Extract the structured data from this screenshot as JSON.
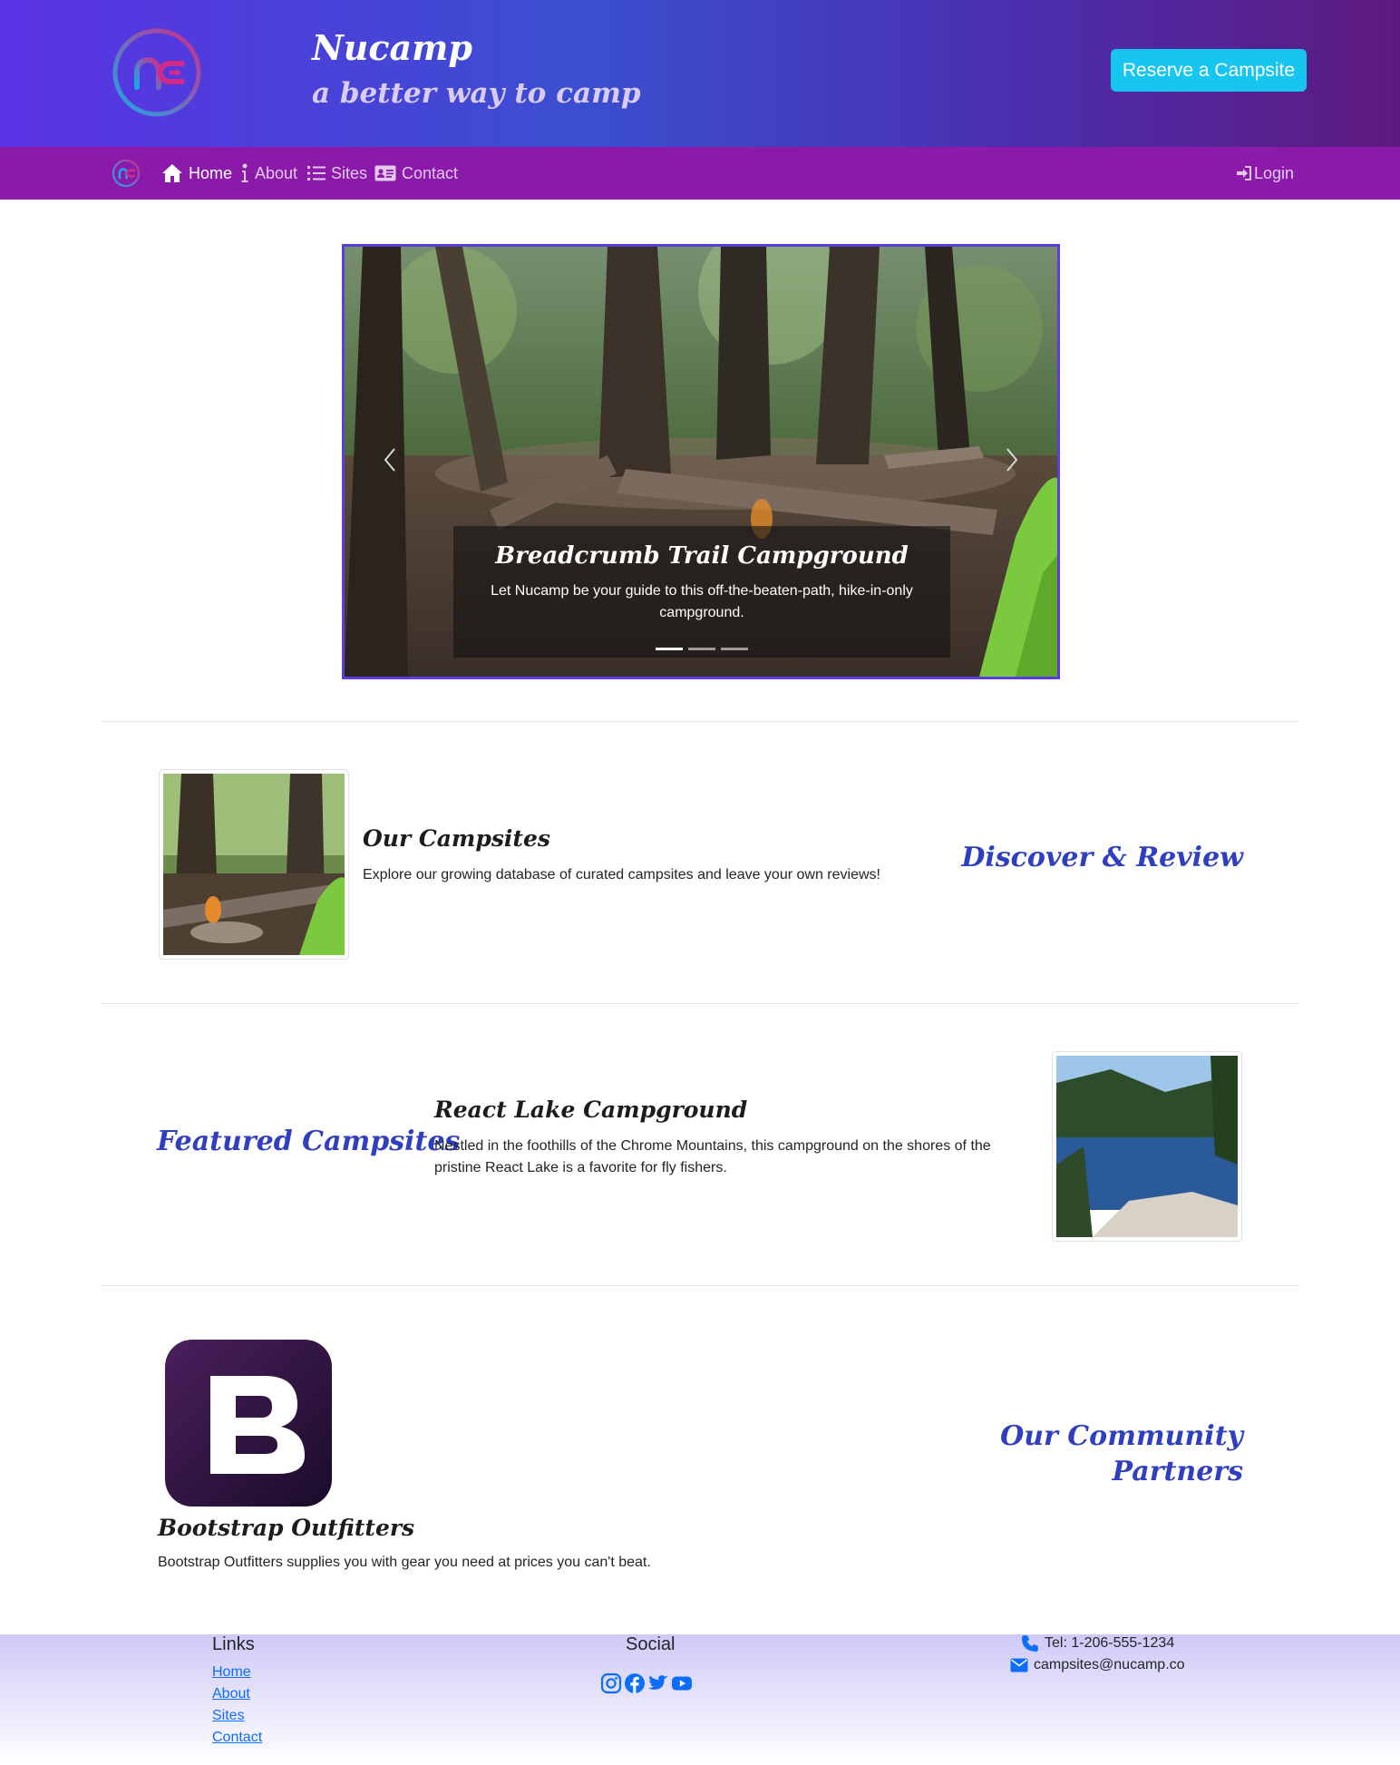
{
  "header": {
    "logo_icon": "nucamp-logo-icon",
    "brand_title": "Nucamp",
    "tagline": "a better way to camp",
    "reserve_button": "Reserve a Campsite",
    "colors": {
      "gradient_start": "#5b32e4",
      "gradient_end": "#5e1a7e",
      "button": "#17c6f0"
    }
  },
  "navbar": {
    "background": "#8b1aab",
    "items": [
      {
        "label": "Home",
        "icon": "home-icon",
        "active": true
      },
      {
        "label": "About",
        "icon": "info-icon",
        "active": false
      },
      {
        "label": "Sites",
        "icon": "list-icon",
        "active": false
      },
      {
        "label": "Contact",
        "icon": "address-card-icon",
        "active": false
      }
    ],
    "login": {
      "label": "Login",
      "icon": "sign-in-icon"
    }
  },
  "carousel": {
    "caption_title": "Breadcrumb Trail Campground",
    "caption_text": "Let Nucamp be your guide to this off-the-beaten-path, hike-in-only campground.",
    "slide_count": 3,
    "active_slide": 1,
    "prev_icon": "chevron-left-icon",
    "next_icon": "chevron-right-icon"
  },
  "sections": {
    "campsites": {
      "title": "Discover & Review",
      "heading": "Our Campsites",
      "text": "Explore our growing database of curated campsites and leave your own reviews!"
    },
    "featured": {
      "title": "Featured Campsites",
      "heading": "React Lake Campground",
      "text": "Nestled in the foothills of the Chrome Mountains, this campground on the shores of the pristine React Lake is a favorite for fly fishers."
    },
    "partners": {
      "title_line1": "Our Community",
      "title_line2": "Partners",
      "logo_letter": "B",
      "heading": "Bootstrap Outfitters",
      "text": "Bootstrap Outfitters supplies you with gear you need at prices you can't beat."
    },
    "title_color": "#2f3fbf"
  },
  "footer": {
    "links_heading": "Links",
    "links": [
      "Home",
      "About",
      "Sites",
      "Contact"
    ],
    "social_heading": "Social",
    "social_icons": [
      "instagram-icon",
      "facebook-icon",
      "twitter-icon",
      "youtube-icon"
    ],
    "phone": "Tel: 1-206-555-1234",
    "email": "campsites@nucamp.co",
    "link_color": "#0d6efd"
  }
}
